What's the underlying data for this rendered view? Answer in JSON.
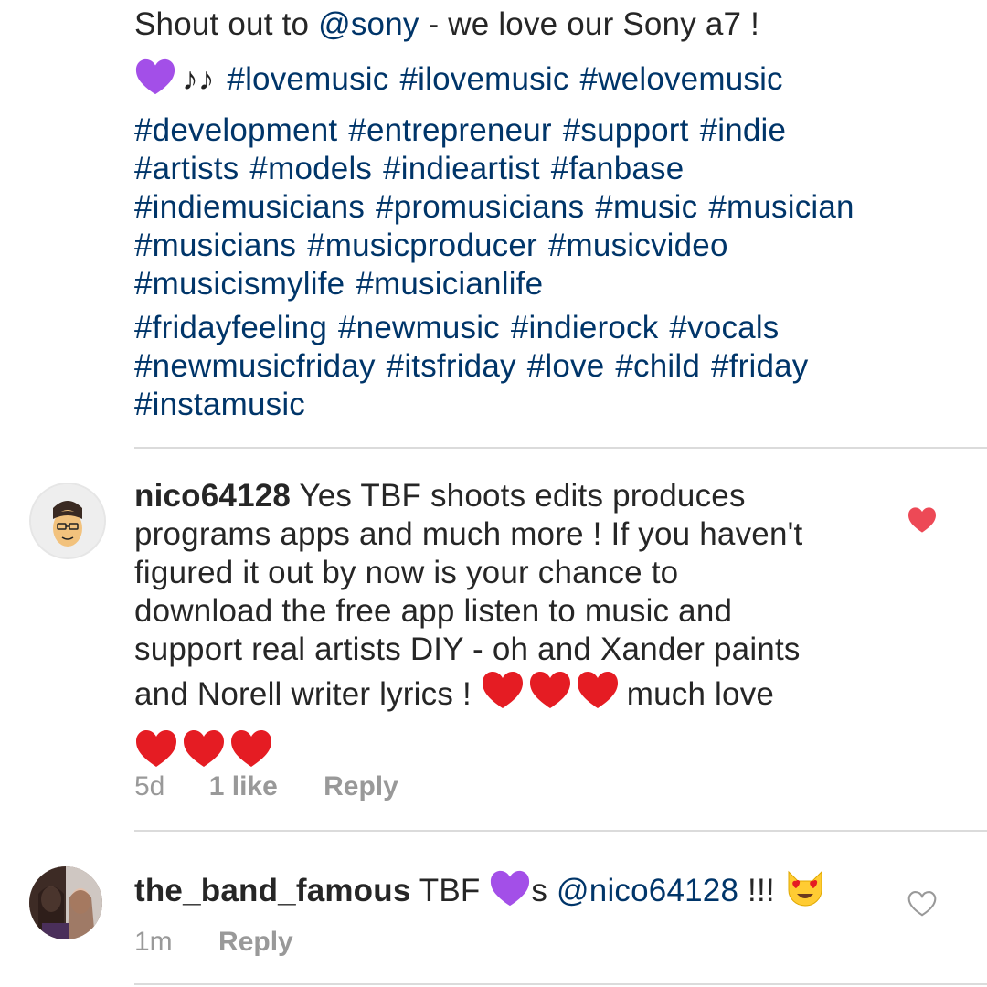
{
  "caption": {
    "line1_prefix": "Shout out to ",
    "mention": "@sony",
    "line1_suffix": " - we love our Sony a7 !",
    "music_note_icon": "♪♪",
    "hashtag_lines": [
      [
        "#lovemusic",
        "#ilovemusic",
        "#welovemusic"
      ],
      [
        "#development",
        "#entrepreneur",
        "#support",
        "#indie"
      ],
      [
        "#artists",
        "#models",
        "#indieartist",
        "#fanbase"
      ],
      [
        "#indiemusicians",
        "#promusicians",
        "#music",
        "#musician"
      ],
      [
        "#musicians",
        "#musicproducer",
        "#musicvideo"
      ],
      [
        "#musicismylife",
        "#musicianlife"
      ],
      [
        "#fridayfeeling",
        "#newmusic",
        "#indierock",
        "#vocals"
      ],
      [
        "#newmusicfriday",
        "#itsfriday",
        "#love",
        "#child",
        "#friday"
      ],
      [
        "#instamusic"
      ]
    ]
  },
  "comment1": {
    "username": "nico64128",
    "lines": [
      " Yes TBF shoots edits produces",
      "programs apps and much more ! If you haven't",
      "figured it out by now is your chance to",
      "download the free app listen to music and",
      "support real artists DIY - oh and Xander paints",
      "and Norell writer lyrics ! "
    ],
    "line6_tail": " much love",
    "time": "5d",
    "likes": "1 like",
    "reply": "Reply",
    "liked": true,
    "colors": {
      "heart": "#ed4956"
    }
  },
  "comment2": {
    "username": "the_band_famous",
    "text_before": " TBF ",
    "text_s": "s ",
    "mention": "@nico64128",
    "text_after": " !!! ",
    "time": "1m",
    "reply": "Reply",
    "liked": false
  },
  "colors": {
    "link": "#003569",
    "text": "#262626",
    "meta": "#999999",
    "divider": "#dbdbdb"
  }
}
